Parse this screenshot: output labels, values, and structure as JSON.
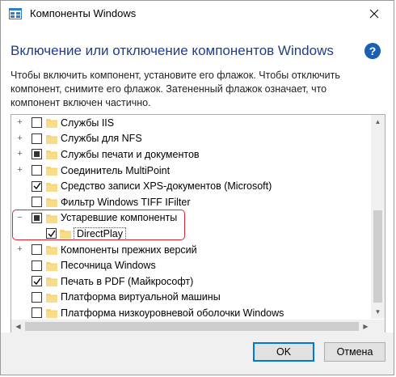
{
  "window": {
    "title": "Компоненты Windows"
  },
  "header": {
    "heading": "Включение или отключение компонентов Windows",
    "description": "Чтобы включить компонент, установите его флажок. Чтобы отключить компонент, снимите его флажок. Затененный флажок означает, что компонент включен частично."
  },
  "tree": {
    "items": [
      {
        "label": "Службы IIS",
        "state": "unchecked",
        "expander": "+"
      },
      {
        "label": "Службы для NFS",
        "state": "unchecked",
        "expander": "+"
      },
      {
        "label": "Службы печати и документов",
        "state": "partial",
        "expander": "+"
      },
      {
        "label": "Соединитель MultiPoint",
        "state": "unchecked",
        "expander": "+"
      },
      {
        "label": "Средство записи XPS-документов (Microsoft)",
        "state": "checked",
        "expander": ""
      },
      {
        "label": "Фильтр Windows TIFF IFilter",
        "state": "unchecked",
        "expander": ""
      },
      {
        "label": "Устаревшие компоненты",
        "state": "partial",
        "expander": "−"
      },
      {
        "label": "DirectPlay",
        "state": "checked",
        "expander": ""
      },
      {
        "label": "Компоненты прежних версий",
        "state": "unchecked",
        "expander": "+"
      },
      {
        "label": "Песочница Windows",
        "state": "unchecked",
        "expander": ""
      },
      {
        "label": "Печать в PDF (Майкрософт)",
        "state": "checked",
        "expander": ""
      },
      {
        "label": "Платформа виртуальной машины",
        "state": "unchecked",
        "expander": ""
      },
      {
        "label": "Платформа низкоуровневой оболочки Windows",
        "state": "unchecked",
        "expander": ""
      }
    ]
  },
  "buttons": {
    "ok": "OK",
    "cancel": "Отмена"
  },
  "colors": {
    "heading": "#1e3e8c",
    "folder": "#f5d374",
    "highlight": "#e0242e",
    "ok_border": "#0078d7"
  }
}
